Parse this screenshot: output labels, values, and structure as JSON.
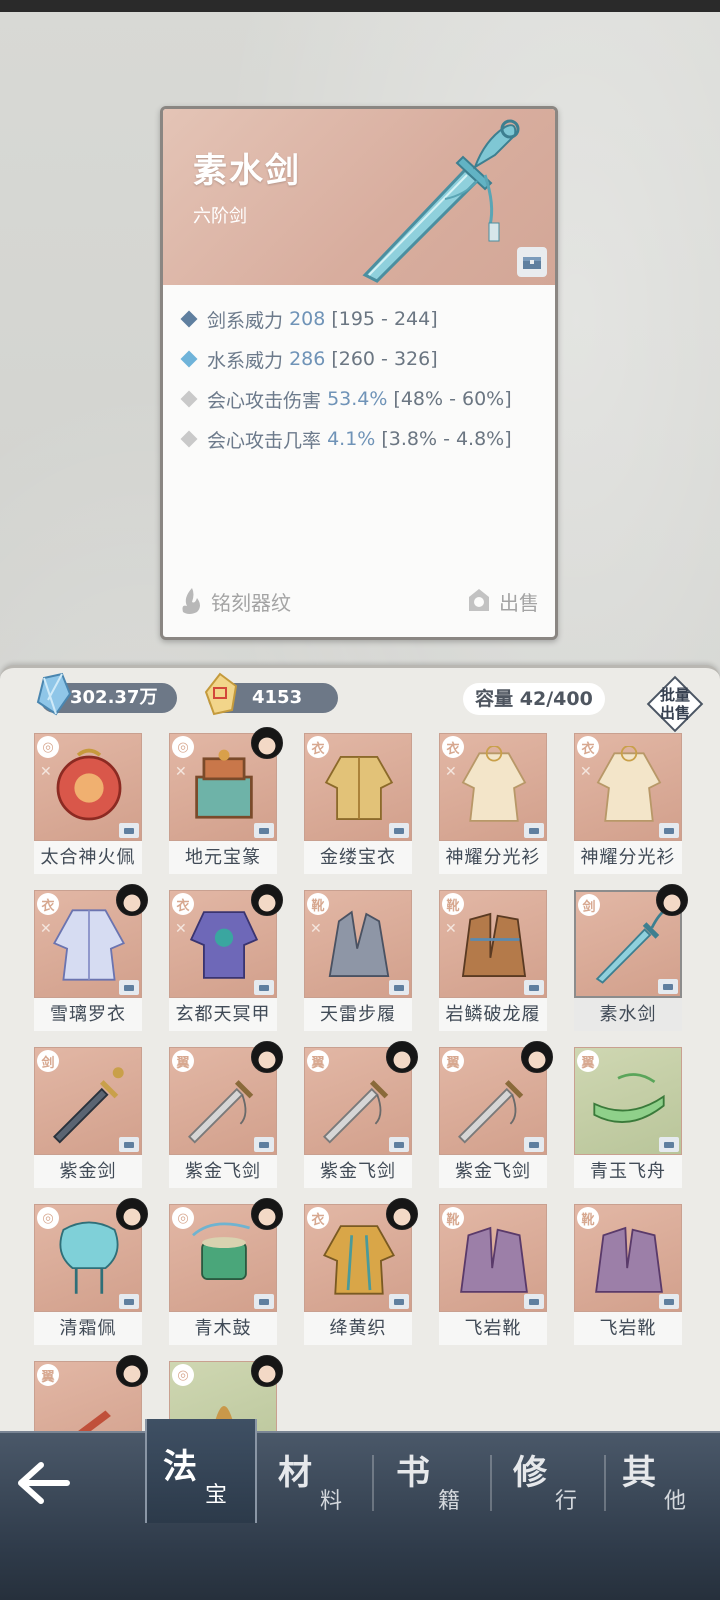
{
  "detail": {
    "title": "素水剑",
    "subtitle": "六阶剑",
    "stats": [
      {
        "label": "剑系威力",
        "value": "208",
        "range": "[195 - 244]",
        "color": "#5f7f9f"
      },
      {
        "label": "水系威力",
        "value": "286",
        "range": "[260 - 326]",
        "color": "#6fb3d9"
      },
      {
        "label": "会心攻击伤害",
        "value": "53.4%",
        "range": "[48% - 60%]",
        "color": "#c9c9c9"
      },
      {
        "label": "会心攻击几率",
        "value": "4.1%",
        "range": "[3.8% - 4.8%]",
        "color": "#c9c9c9"
      }
    ],
    "engrave_label": "铭刻器纹",
    "sell_label": "出售"
  },
  "inventory": {
    "spirit_stones": "302.37万",
    "gold": "4153",
    "capacity": "容量 42/400",
    "batch_sell_line1": "批量",
    "batch_sell_line2": "出售",
    "items": [
      {
        "name": "太合神火佩",
        "badge": "◎",
        "avatar": false,
        "mark": true,
        "art": "pendant-red"
      },
      {
        "name": "地元宝篆",
        "badge": "◎",
        "avatar": true,
        "mark": true,
        "art": "seal"
      },
      {
        "name": "金缕宝衣",
        "badge": "衣",
        "avatar": false,
        "mark": false,
        "art": "robe-gold"
      },
      {
        "name": "神耀分光衫",
        "badge": "衣",
        "avatar": false,
        "mark": true,
        "art": "robe-cream"
      },
      {
        "name": "神耀分光衫",
        "badge": "衣",
        "avatar": false,
        "mark": true,
        "art": "robe-cream"
      },
      {
        "name": "雪璃罗衣",
        "badge": "衣",
        "avatar": true,
        "mark": true,
        "art": "robe-blue"
      },
      {
        "name": "玄都天冥甲",
        "badge": "衣",
        "avatar": true,
        "mark": true,
        "art": "armor-purple"
      },
      {
        "name": "天雷步履",
        "badge": "靴",
        "avatar": false,
        "mark": true,
        "art": "boots-grey"
      },
      {
        "name": "岩鳞破龙履",
        "badge": "靴",
        "avatar": false,
        "mark": true,
        "art": "boots-brown"
      },
      {
        "name": "素水剑",
        "badge": "剑",
        "avatar": true,
        "mark": false,
        "art": "sword-cyan",
        "selected": true
      },
      {
        "name": "紫金剑",
        "badge": "剑",
        "avatar": false,
        "mark": false,
        "art": "sword-dark"
      },
      {
        "name": "紫金飞剑",
        "badge": "翼",
        "avatar": true,
        "mark": false,
        "art": "sword-silver"
      },
      {
        "name": "紫金飞剑",
        "badge": "翼",
        "avatar": true,
        "mark": false,
        "art": "sword-silver"
      },
      {
        "name": "紫金飞剑",
        "badge": "翼",
        "avatar": true,
        "mark": false,
        "art": "sword-silver"
      },
      {
        "name": "青玉飞舟",
        "badge": "翼",
        "avatar": false,
        "mark": false,
        "art": "boat-green",
        "green": true
      },
      {
        "name": "清霜佩",
        "badge": "◎",
        "avatar": true,
        "mark": false,
        "art": "pendant-cyan"
      },
      {
        "name": "青木鼓",
        "badge": "◎",
        "avatar": true,
        "mark": false,
        "art": "drum"
      },
      {
        "name": "绛黄织",
        "badge": "衣",
        "avatar": true,
        "mark": false,
        "art": "robe-yellow"
      },
      {
        "name": "飞岩靴",
        "badge": "靴",
        "avatar": false,
        "mark": false,
        "art": "boots-purple"
      },
      {
        "name": "飞岩靴",
        "badge": "靴",
        "avatar": false,
        "mark": false,
        "art": "boots-purple"
      },
      {
        "name": "",
        "badge": "翼",
        "avatar": true,
        "mark": false,
        "art": "partial-red"
      },
      {
        "name": "",
        "badge": "◎",
        "avatar": true,
        "mark": false,
        "art": "partial-gold",
        "green": true
      }
    ]
  },
  "nav": {
    "back_icon": "arrow-left-icon",
    "tabs": [
      {
        "big": "法",
        "small": "宝",
        "active": true
      },
      {
        "big": "材",
        "small": "料"
      },
      {
        "big": "书",
        "small": "籍"
      },
      {
        "big": "修",
        "small": "行"
      },
      {
        "big": "其",
        "small": "他"
      }
    ]
  }
}
